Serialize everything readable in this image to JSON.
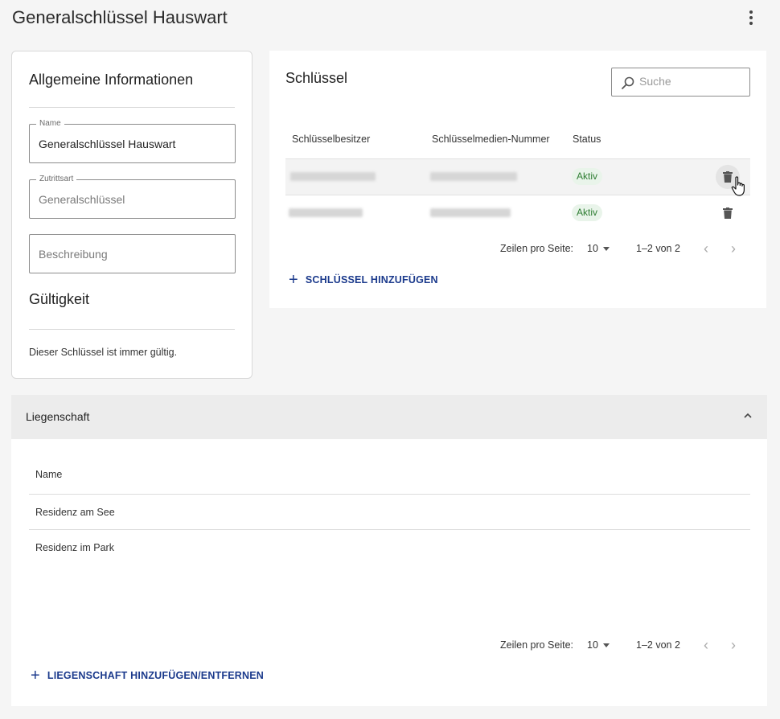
{
  "page": {
    "title": "Generalschlüssel Hauswart"
  },
  "info": {
    "heading": "Allgemeine Informationen",
    "name_label": "Name",
    "name_value": "Generalschlüssel Hauswart",
    "access_label": "Zutrittsart",
    "access_value": "Generalschlüssel",
    "description_placeholder": "Beschreibung",
    "validity_heading": "Gültigkeit",
    "validity_text": "Dieser Schlüssel ist immer gültig."
  },
  "keys": {
    "heading": "Schlüssel",
    "search_placeholder": "Suche",
    "columns": [
      "Schlüsselbesitzer",
      "Schlüsselmedien-Nummer",
      "Status"
    ],
    "rows": [
      {
        "status": "Aktiv"
      },
      {
        "status": "Aktiv"
      }
    ],
    "pagination": {
      "rows_label": "Zeilen pro Seite:",
      "rows_value": "10",
      "range": "1–2 von 2"
    },
    "add_label": "SCHLÜSSEL HINZUFÜGEN"
  },
  "property": {
    "heading": "Liegenschaft",
    "column": "Name",
    "rows": [
      "Residenz am See",
      "Residenz im Park"
    ],
    "pagination": {
      "rows_label": "Zeilen pro Seite:",
      "rows_value": "10",
      "range": "1–2 von 2"
    },
    "add_label": "LIEGENSCHAFT HINZUFÜGEN/ENTFERNEN"
  },
  "colors": {
    "accent": "#1b3a8c",
    "status_green": "#2e7d32",
    "status_bg": "#e9f4ea"
  },
  "icons": [
    "more-vert-icon",
    "search-icon",
    "trash-icon",
    "chevron-left-icon",
    "chevron-right-icon",
    "chevron-up-icon",
    "plus-icon",
    "hand-cursor-icon"
  ]
}
